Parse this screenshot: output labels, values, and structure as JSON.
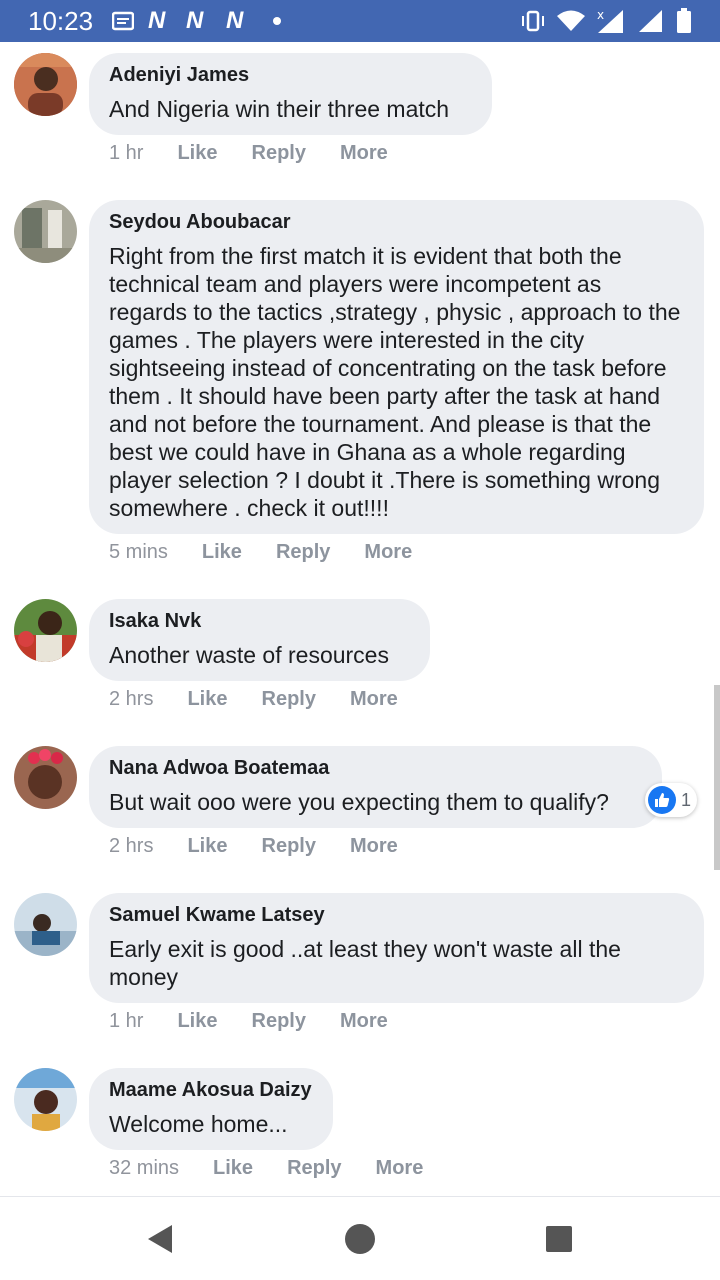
{
  "status_bar": {
    "time": "10:23",
    "bg_color": "#4267b2",
    "icons": [
      "message-icon",
      "n-icon",
      "n-icon",
      "n-icon",
      "dot-icon",
      "vibrate-icon",
      "wifi-icon",
      "signal-x-icon",
      "signal-icon",
      "battery-icon"
    ]
  },
  "comments": [
    {
      "author": "Adeniyi James",
      "text": "And Nigeria win their three match",
      "time": "1 hr",
      "like": "Like",
      "reply": "Reply",
      "more": "More"
    },
    {
      "author": "Seydou Aboubacar",
      "text": "Right from the first match it is evident that both the technical team and players were incompetent as regards to the tactics ,strategy , physic , approach to the games . The players were interested in the city sightseeing instead of concentrating on the task before them . It should have been party after the task at hand and not before the tournament. And please is that the best we could have in Ghana as a whole regarding player selection ? I doubt it .There is something wrong somewhere . check it out!!!!",
      "time": "5 mins",
      "like": "Like",
      "reply": "Reply",
      "more": "More"
    },
    {
      "author": "Isaka Nvk",
      "text": "Another waste of resources",
      "time": "2 hrs",
      "like": "Like",
      "reply": "Reply",
      "more": "More"
    },
    {
      "author": "Nana Adwoa Boatemaa",
      "text": "But wait ooo were you expecting them to qualify?",
      "time": "2 hrs",
      "like": "Like",
      "reply": "Reply",
      "more": "More",
      "reaction_count": "1"
    },
    {
      "author": "Samuel Kwame Latsey",
      "text": "Early exit is good ..at least they won't waste all the money",
      "time": "1 hr",
      "like": "Like",
      "reply": "Reply",
      "more": "More"
    },
    {
      "author": "Maame Akosua Daizy",
      "text": "Welcome home...",
      "time": "32 mins",
      "like": "Like",
      "reply": "Reply",
      "more": "More"
    }
  ],
  "nav_bar": {
    "buttons": [
      "back-icon",
      "home-icon",
      "recents-icon"
    ]
  }
}
